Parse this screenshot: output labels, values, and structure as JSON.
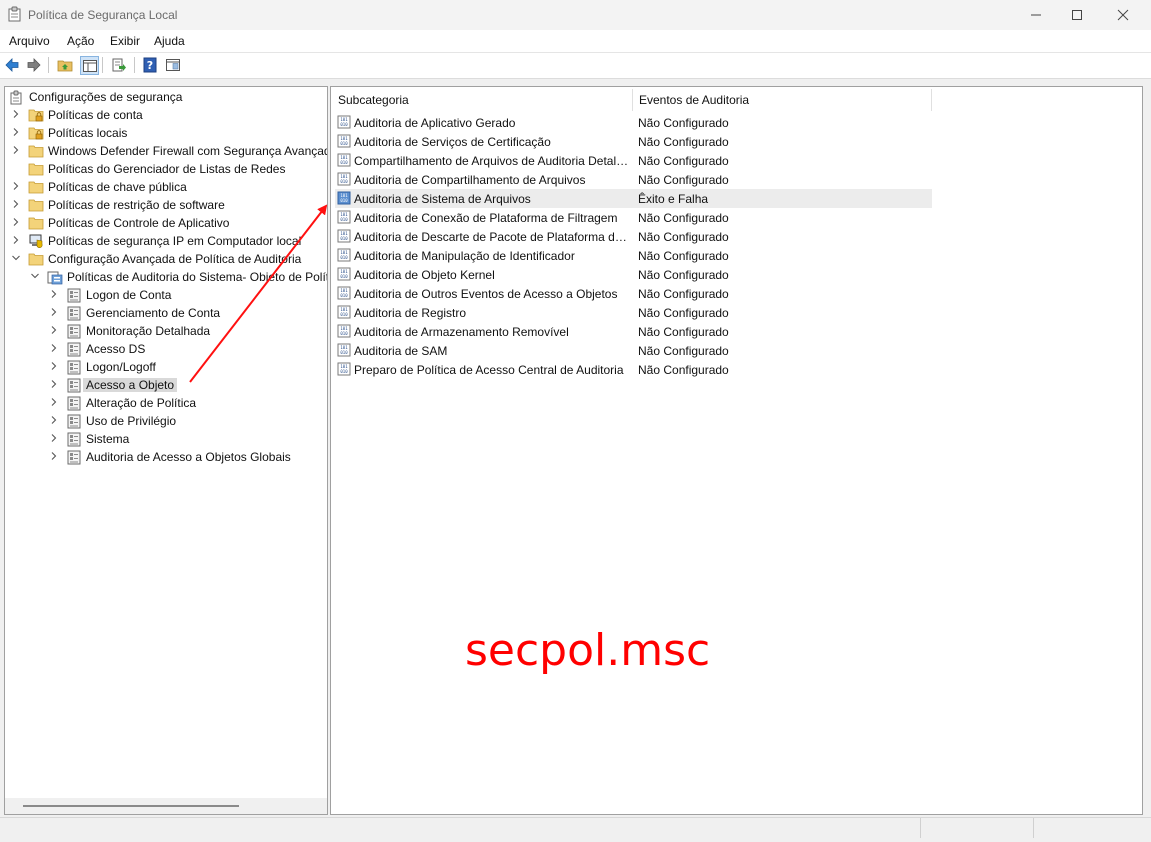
{
  "window": {
    "title": "Política de Segurança Local",
    "icon": "security-policy-icon",
    "controls": [
      "minimize-icon",
      "maximize-icon",
      "close-icon"
    ]
  },
  "menu": [
    "Arquivo",
    "Ação",
    "Exibir",
    "Ajuda"
  ],
  "toolbar": [
    "back-arrow-icon",
    "forward-arrow-icon",
    "up-folder-icon",
    "show-hide-tree-icon",
    "export-list-icon",
    "help-icon",
    "properties-icon"
  ],
  "tree": {
    "root": "Configurações de segurança",
    "items": [
      {
        "label": "Políticas de conta",
        "level": 1,
        "expander": "collapsed",
        "icon": "folder-lock-icon"
      },
      {
        "label": "Políticas locais",
        "level": 1,
        "expander": "collapsed",
        "icon": "folder-lock-icon"
      },
      {
        "label": "Windows Defender Firewall com Segurança Avançada",
        "level": 1,
        "expander": "collapsed",
        "icon": "folder-icon"
      },
      {
        "label": "Políticas do Gerenciador de Listas de Redes",
        "level": 1,
        "expander": "none",
        "icon": "folder-icon"
      },
      {
        "label": "Políticas de chave pública",
        "level": 1,
        "expander": "collapsed",
        "icon": "folder-icon"
      },
      {
        "label": "Políticas de restrição de software",
        "level": 1,
        "expander": "collapsed",
        "icon": "folder-icon"
      },
      {
        "label": "Políticas de Controle de Aplicativo",
        "level": 1,
        "expander": "collapsed",
        "icon": "folder-icon"
      },
      {
        "label": "Políticas de segurança IP em Computador local",
        "level": 1,
        "expander": "collapsed",
        "icon": "ip-security-icon"
      },
      {
        "label": "Configuração Avançada de Política de Auditoria",
        "level": 1,
        "expander": "expanded",
        "icon": "folder-icon"
      },
      {
        "label": "Políticas de Auditoria do Sistema- Objeto de Política de Grupo Local",
        "level": 2,
        "expander": "expanded",
        "icon": "audit-policy-icon"
      },
      {
        "label": "Logon de Conta",
        "level": 3,
        "expander": "collapsed",
        "icon": "audit-category-icon"
      },
      {
        "label": "Gerenciamento de Conta",
        "level": 3,
        "expander": "collapsed",
        "icon": "audit-category-icon"
      },
      {
        "label": "Monitoração Detalhada",
        "level": 3,
        "expander": "collapsed",
        "icon": "audit-category-icon"
      },
      {
        "label": "Acesso DS",
        "level": 3,
        "expander": "collapsed",
        "icon": "audit-category-icon"
      },
      {
        "label": "Logon/Logoff",
        "level": 3,
        "expander": "collapsed",
        "icon": "audit-category-icon"
      },
      {
        "label": "Acesso a Objeto",
        "level": 3,
        "expander": "collapsed",
        "icon": "audit-category-icon",
        "selected": true
      },
      {
        "label": "Alteração de Política",
        "level": 3,
        "expander": "collapsed",
        "icon": "audit-category-icon"
      },
      {
        "label": "Uso de Privilégio",
        "level": 3,
        "expander": "collapsed",
        "icon": "audit-category-icon"
      },
      {
        "label": "Sistema",
        "level": 3,
        "expander": "collapsed",
        "icon": "audit-category-icon"
      },
      {
        "label": "Auditoria de Acesso a Objetos Globais",
        "level": 3,
        "expander": "collapsed",
        "icon": "audit-category-icon"
      }
    ]
  },
  "list": {
    "columns": [
      "Subcategoria",
      "Eventos de Auditoria"
    ],
    "rows": [
      {
        "name": "Auditoria de Aplicativo Gerado",
        "value": "Não Configurado"
      },
      {
        "name": "Auditoria de Serviços de Certificação",
        "value": "Não Configurado"
      },
      {
        "name": "Compartilhamento de Arquivos de Auditoria Detalhado",
        "value": "Não Configurado"
      },
      {
        "name": "Auditoria de Compartilhamento de Arquivos",
        "value": "Não Configurado"
      },
      {
        "name": "Auditoria de Sistema de Arquivos",
        "value": "Êxito e Falha",
        "selected": true
      },
      {
        "name": "Auditoria de Conexão de Plataforma de Filtragem",
        "value": "Não Configurado"
      },
      {
        "name": "Auditoria de Descarte de Pacote de Plataforma de Filtragem",
        "value": "Não Configurado"
      },
      {
        "name": "Auditoria de Manipulação de Identificador",
        "value": "Não Configurado"
      },
      {
        "name": "Auditoria de Objeto Kernel",
        "value": "Não Configurado"
      },
      {
        "name": "Auditoria de Outros Eventos de Acesso a Objetos",
        "value": "Não Configurado"
      },
      {
        "name": "Auditoria de Registro",
        "value": "Não Configurado"
      },
      {
        "name": "Auditoria de Armazenamento Removível",
        "value": "Não Configurado"
      },
      {
        "name": "Auditoria de SAM",
        "value": "Não Configurado"
      },
      {
        "name": "Preparo de Política de Acesso Central de Auditoria",
        "value": "Não Configurado"
      }
    ]
  },
  "annotation": {
    "text": "secpol.msc",
    "color": "#ff0000"
  }
}
